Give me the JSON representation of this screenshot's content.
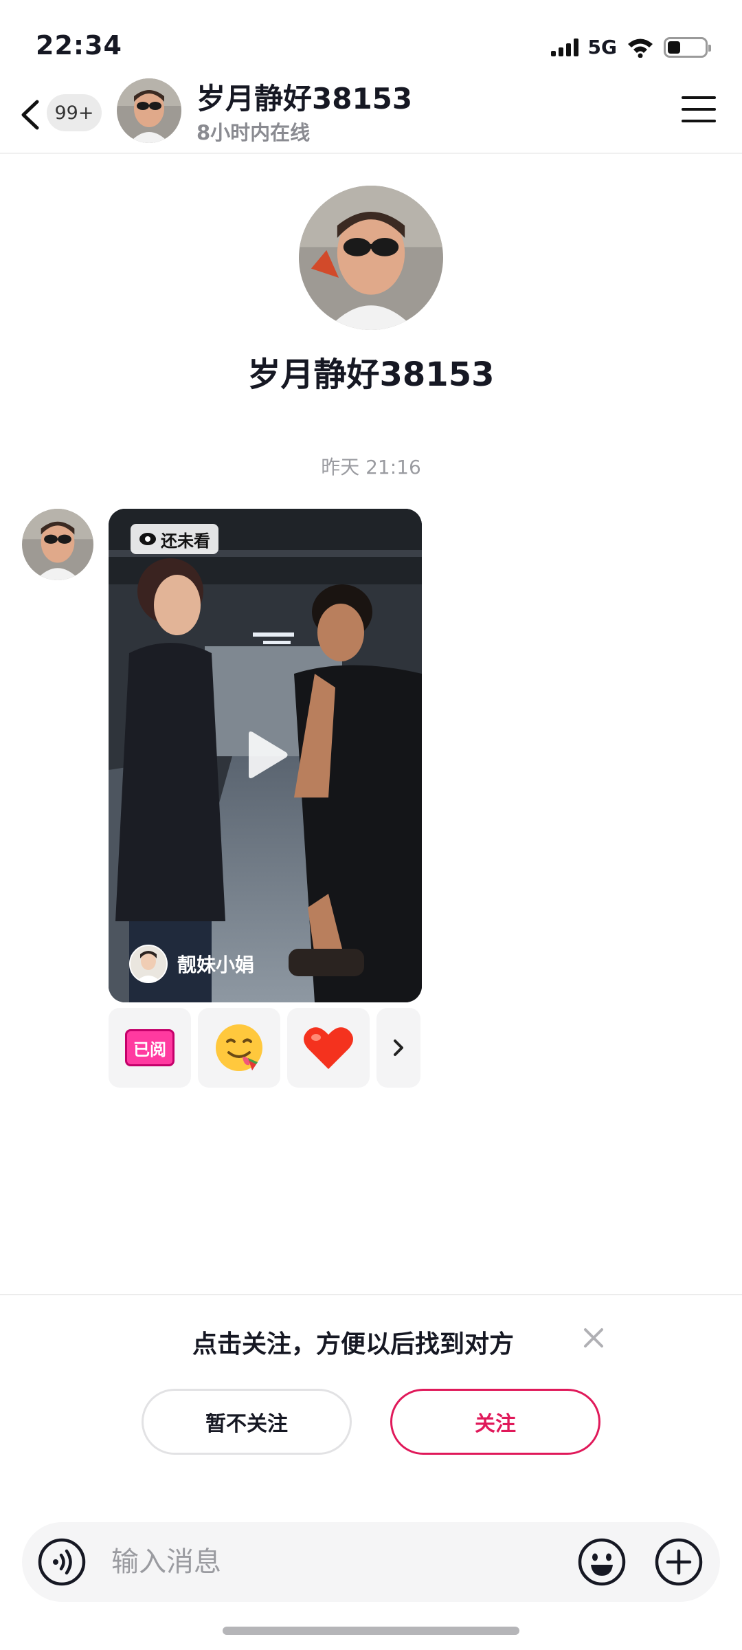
{
  "status_bar": {
    "time": "22:34",
    "network": "5G",
    "battery_level": 0.35,
    "icons": [
      "signal-icon",
      "wifi-icon",
      "battery-icon"
    ]
  },
  "header": {
    "back_icon": "chevron-left-icon",
    "unread_badge": "99+",
    "contact_name": "岁月静好38153",
    "online_status": "8小时内在线",
    "menu_icon": "hamburger-menu-icon"
  },
  "profile": {
    "name": "岁月静好38153"
  },
  "conversation": {
    "timestamp": "昨天 21:16",
    "video_message": {
      "unseen_label": "还未看",
      "author_name": "靓妹小娟",
      "play_icon": "play-icon"
    },
    "reactions": [
      {
        "label": "已阅",
        "icon": "read-stamp-icon"
      },
      {
        "label": "",
        "icon": "yummy-face-emoji-icon"
      },
      {
        "label": "",
        "icon": "red-heart-emoji-icon"
      },
      {
        "label": "",
        "icon": "chevron-right-icon"
      }
    ]
  },
  "follow_prompt": {
    "text": "点击关注，方便以后找到对方",
    "skip_label": "暂不关注",
    "follow_label": "关注",
    "accent_color": "#e0195a",
    "close_icon": "close-icon"
  },
  "input_bar": {
    "placeholder": "输入消息",
    "value": "",
    "voice_icon": "voice-input-icon",
    "emoji_icon": "emoji-icon",
    "plus_icon": "plus-icon"
  }
}
